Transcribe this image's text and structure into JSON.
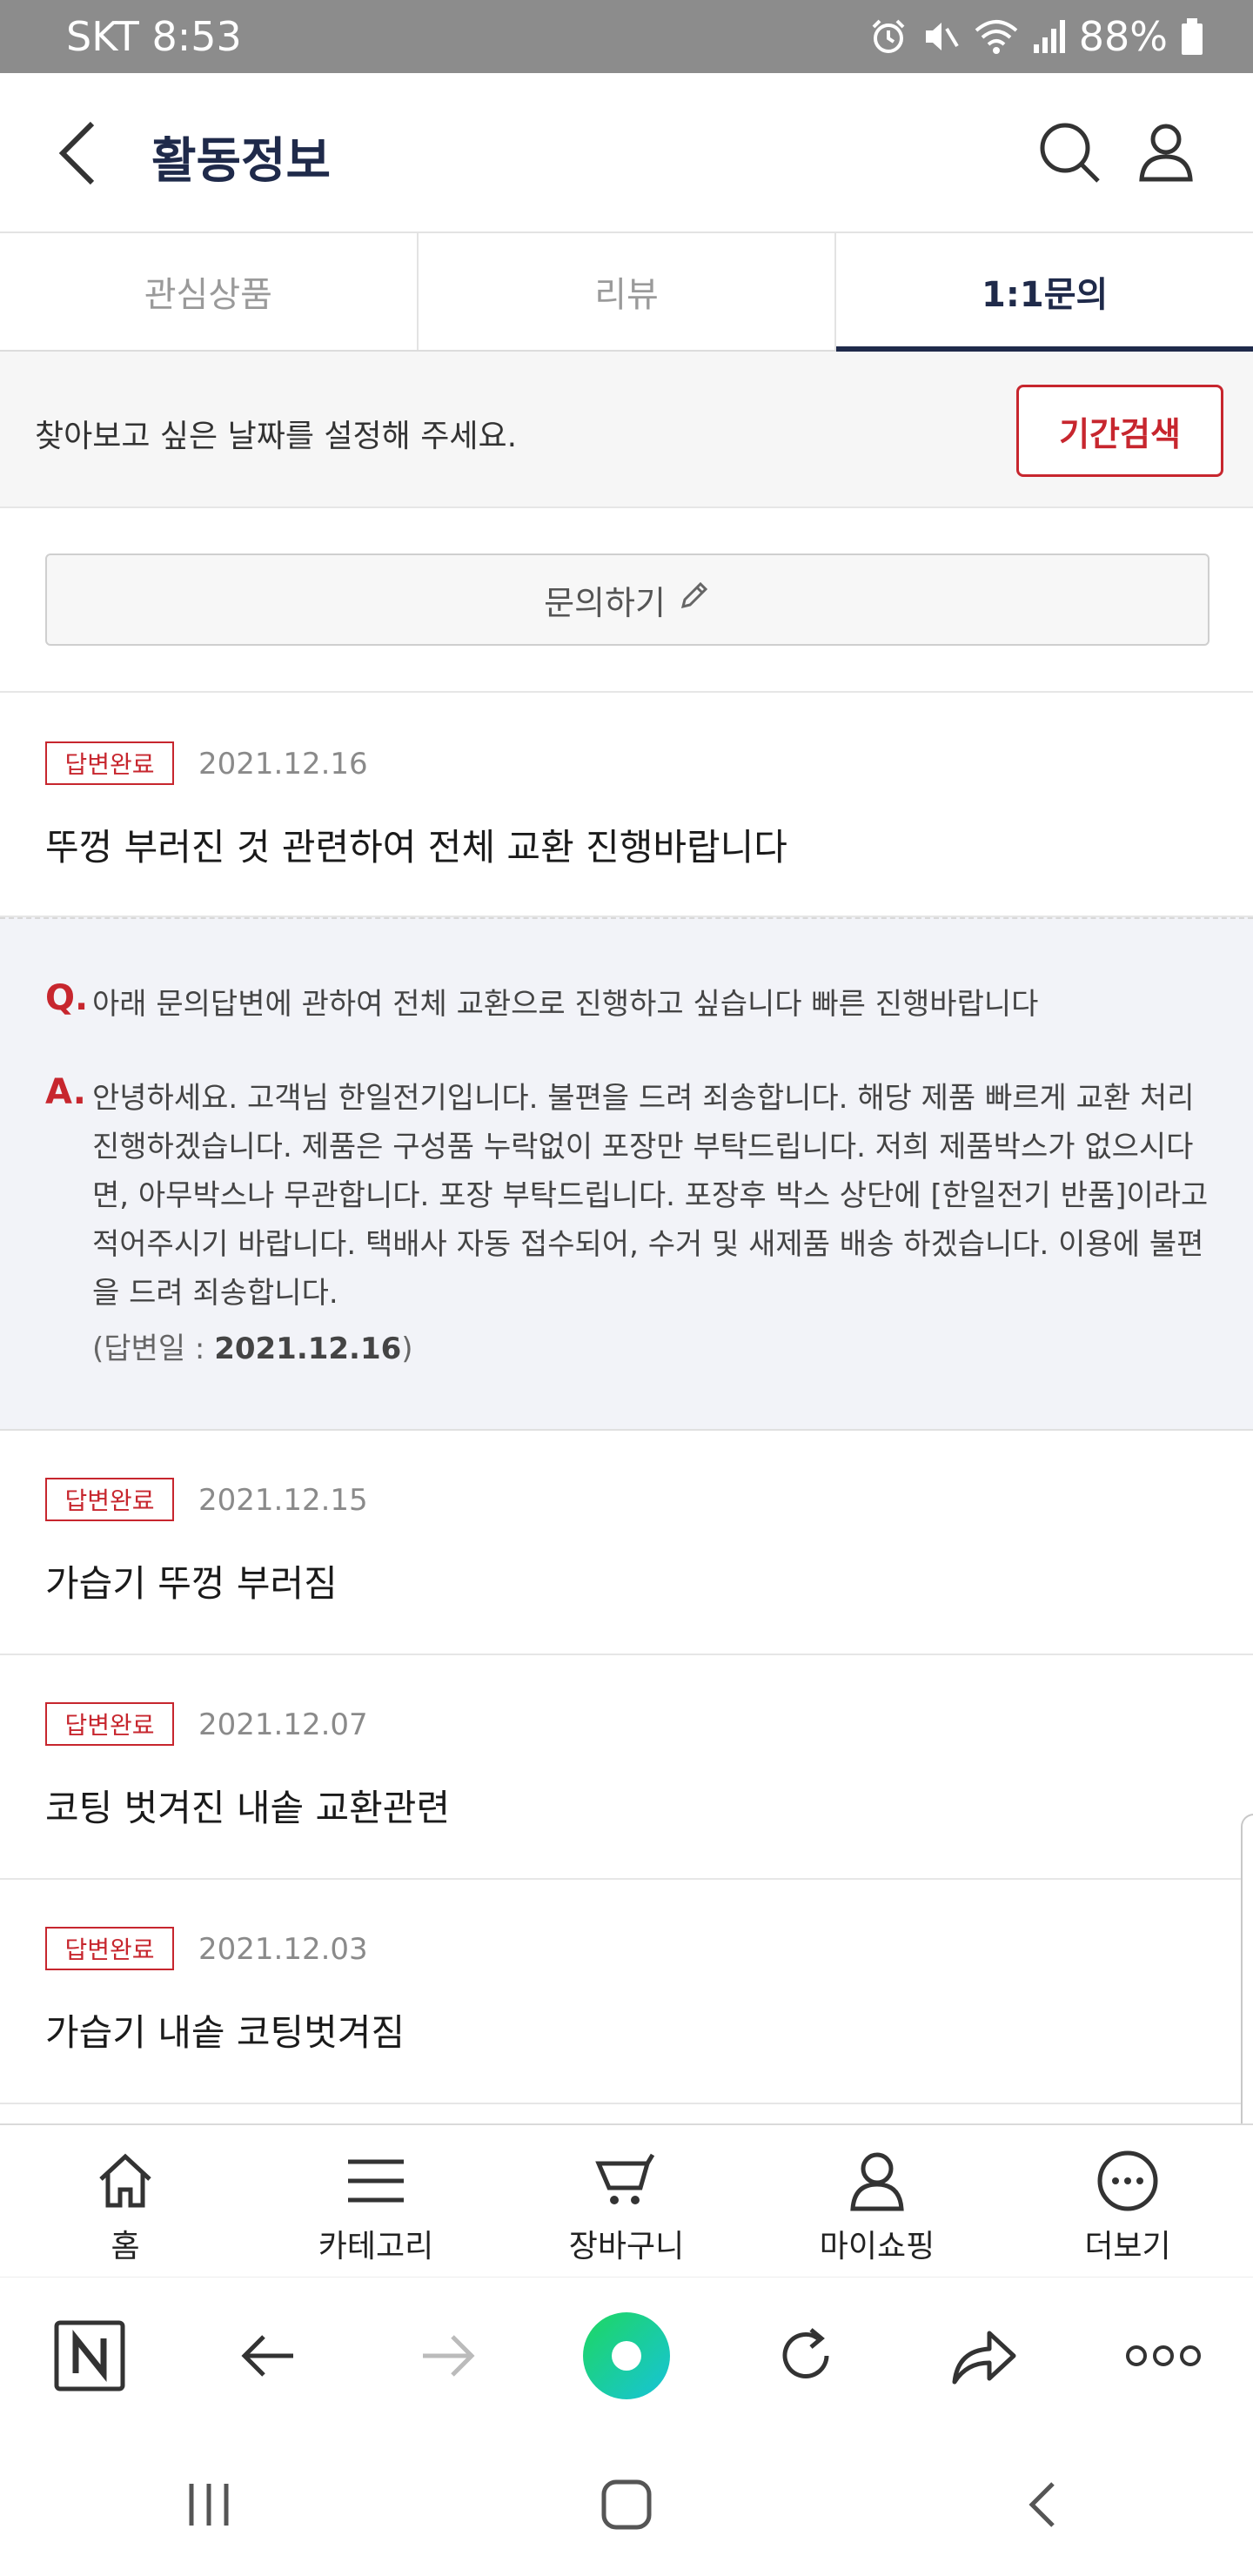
{
  "status_bar": {
    "carrier_time": "SKT 8:53",
    "battery": "88%"
  },
  "header": {
    "title": "활동정보"
  },
  "tabs": [
    {
      "label": "관심상품"
    },
    {
      "label": "리뷰"
    },
    {
      "label": "1:1문의"
    }
  ],
  "date_filter": {
    "prompt": "찾아보고 싶은 날짜를 설정해 주세요.",
    "button": "기간검색"
  },
  "ask_button": "문의하기",
  "inquiries": [
    {
      "status": "답변완료",
      "date": "2021.12.16",
      "title": "뚜껑 부러진 것 관련하여 전체 교환 진행바랍니다"
    },
    {
      "status": "답변완료",
      "date": "2021.12.15",
      "title": "가습기 뚜껑 부러짐"
    },
    {
      "status": "답변완료",
      "date": "2021.12.07",
      "title": "코팅 벗겨진 내솥 교환관련"
    },
    {
      "status": "답변완료",
      "date": "2021.12.03",
      "title": "가습기 내솥 코팅벗겨짐"
    }
  ],
  "qa": {
    "q_mark": "Q.",
    "question": "아래 문의답변에 관하여 전체 교환으로 진행하고 싶습니다 빠른 진행바랍니다",
    "a_mark": "A.",
    "answer": "안녕하세요. 고객님 한일전기입니다. 불편을 드려 죄송합니다. 해당 제품 빠르게 교환 처리 진행하겠습니다. 제품은 구성품 누락없이 포장만 부탁드립니다. 저희 제품박스가 없으시다면, 아무박스나 무관합니다. 포장 부탁드립니다. 포장후 박스 상단에 [한일전기 반품]이라고 적어주시기 바랍니다. 택배사 자동 접수되어, 수거 및 새제품 배송 하겠습니다. 이용에 불편을 드려 죄송합니다.",
    "answer_date_label": "(답변일 : ",
    "answer_date": "2021.12.16",
    "answer_date_close": ")"
  },
  "bottom_nav": [
    {
      "label": "홈",
      "icon": "home-icon"
    },
    {
      "label": "카테고리",
      "icon": "menu-icon"
    },
    {
      "label": "장바구니",
      "icon": "cart-icon"
    },
    {
      "label": "마이쇼핑",
      "icon": "person-icon"
    },
    {
      "label": "더보기",
      "icon": "more-icon"
    }
  ],
  "colors": {
    "accent_red": "#c7262e",
    "navy": "#1f2a4a",
    "status_bar": "#8c8c8c"
  }
}
